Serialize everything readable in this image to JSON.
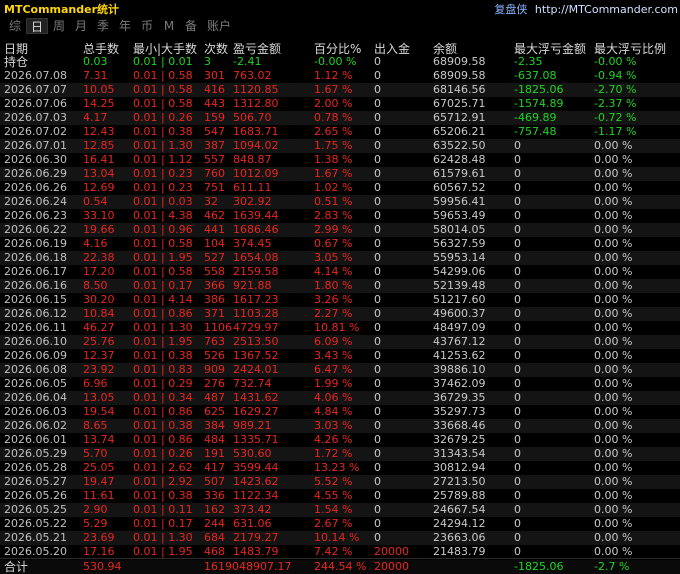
{
  "app_title": "MTCommander统计",
  "top_right": {
    "label": "复盘侠",
    "site": "http://MTCommander.com"
  },
  "tabs": [
    {
      "label": "综"
    },
    {
      "label": "日"
    },
    {
      "label": "周"
    },
    {
      "label": "月"
    },
    {
      "label": "季"
    },
    {
      "label": "年"
    },
    {
      "label": "币"
    },
    {
      "label": "M"
    },
    {
      "label": "备"
    },
    {
      "label": "账户"
    }
  ],
  "active_tab": "日",
  "headers": [
    "日期",
    "总手数",
    "最小|大手数",
    "次数",
    "盈亏金额",
    "百分比%",
    "出入金",
    "余额",
    "最大浮亏金额",
    "最大浮亏比例"
  ],
  "holding": {
    "label": "持仓",
    "lots": "0.03",
    "minmax": "0.01 | 0.01",
    "count": "3",
    "pnl": "-2.41",
    "pct": "-0.00 %",
    "flow": "0",
    "balance": "68909.58",
    "maxdd": "-2.35",
    "maxdd_pct": "-0.00 %"
  },
  "rows": [
    {
      "date": "2026.07.08",
      "lots": "7.31",
      "minmax": "0.01 | 0.58",
      "count": "301",
      "pnl": "763.02",
      "pct": "1.12 %",
      "flow": "0",
      "balance": "68909.58",
      "maxdd": "-637.08",
      "maxdd_pct": "-0.94 %"
    },
    {
      "date": "2026.07.07",
      "lots": "10.05",
      "minmax": "0.01 | 0.58",
      "count": "416",
      "pnl": "1120.85",
      "pct": "1.67 %",
      "flow": "0",
      "balance": "68146.56",
      "maxdd": "-1825.06",
      "maxdd_pct": "-2.70 %"
    },
    {
      "date": "2026.07.06",
      "lots": "14.25",
      "minmax": "0.01 | 0.58",
      "count": "443",
      "pnl": "1312.80",
      "pct": "2.00 %",
      "flow": "0",
      "balance": "67025.71",
      "maxdd": "-1574.89",
      "maxdd_pct": "-2.37 %"
    },
    {
      "date": "2026.07.03",
      "lots": "4.17",
      "minmax": "0.01 | 0.26",
      "count": "159",
      "pnl": "506.70",
      "pct": "0.78 %",
      "flow": "0",
      "balance": "65712.91",
      "maxdd": "-469.89",
      "maxdd_pct": "-0.72 %"
    },
    {
      "date": "2026.07.02",
      "lots": "12.43",
      "minmax": "0.01 | 0.38",
      "count": "547",
      "pnl": "1683.71",
      "pct": "2.65 %",
      "flow": "0",
      "balance": "65206.21",
      "maxdd": "-757.48",
      "maxdd_pct": "-1.17 %"
    },
    {
      "date": "2026.07.01",
      "lots": "12.85",
      "minmax": "0.01 | 1.30",
      "count": "387",
      "pnl": "1094.02",
      "pct": "1.75 %",
      "flow": "0",
      "balance": "63522.50",
      "maxdd": "0",
      "maxdd_pct": "0.00 %"
    },
    {
      "date": "2026.06.30",
      "lots": "16.41",
      "minmax": "0.01 | 1.12",
      "count": "557",
      "pnl": "848.87",
      "pct": "1.38 %",
      "flow": "0",
      "balance": "62428.48",
      "maxdd": "0",
      "maxdd_pct": "0.00 %"
    },
    {
      "date": "2026.06.29",
      "lots": "13.04",
      "minmax": "0.01 | 0.23",
      "count": "760",
      "pnl": "1012.09",
      "pct": "1.67 %",
      "flow": "0",
      "balance": "61579.61",
      "maxdd": "0",
      "maxdd_pct": "0.00 %"
    },
    {
      "date": "2026.06.26",
      "lots": "12.69",
      "minmax": "0.01 | 0.23",
      "count": "751",
      "pnl": "611.11",
      "pct": "1.02 %",
      "flow": "0",
      "balance": "60567.52",
      "maxdd": "0",
      "maxdd_pct": "0.00 %"
    },
    {
      "date": "2026.06.24",
      "lots": "0.54",
      "minmax": "0.01 | 0.03",
      "count": "32",
      "pnl": "302.92",
      "pct": "0.51 %",
      "flow": "0",
      "balance": "59956.41",
      "maxdd": "0",
      "maxdd_pct": "0.00 %"
    },
    {
      "date": "2026.06.23",
      "lots": "33.10",
      "minmax": "0.01 | 4.38",
      "count": "462",
      "pnl": "1639.44",
      "pct": "2.83 %",
      "flow": "0",
      "balance": "59653.49",
      "maxdd": "0",
      "maxdd_pct": "0.00 %"
    },
    {
      "date": "2026.06.22",
      "lots": "19.66",
      "minmax": "0.01 | 0.96",
      "count": "441",
      "pnl": "1686.46",
      "pct": "2.99 %",
      "flow": "0",
      "balance": "58014.05",
      "maxdd": "0",
      "maxdd_pct": "0.00 %"
    },
    {
      "date": "2026.06.19",
      "lots": "4.16",
      "minmax": "0.01 | 0.58",
      "count": "104",
      "pnl": "374.45",
      "pct": "0.67 %",
      "flow": "0",
      "balance": "56327.59",
      "maxdd": "0",
      "maxdd_pct": "0.00 %"
    },
    {
      "date": "2026.06.18",
      "lots": "22.38",
      "minmax": "0.01 | 1.95",
      "count": "527",
      "pnl": "1654.08",
      "pct": "3.05 %",
      "flow": "0",
      "balance": "55953.14",
      "maxdd": "0",
      "maxdd_pct": "0.00 %"
    },
    {
      "date": "2026.06.17",
      "lots": "17.20",
      "minmax": "0.01 | 0.58",
      "count": "558",
      "pnl": "2159.58",
      "pct": "4.14 %",
      "flow": "0",
      "balance": "54299.06",
      "maxdd": "0",
      "maxdd_pct": "0.00 %"
    },
    {
      "date": "2026.06.16",
      "lots": "8.50",
      "minmax": "0.01 | 0.17",
      "count": "366",
      "pnl": "921.88",
      "pct": "1.80 %",
      "flow": "0",
      "balance": "52139.48",
      "maxdd": "0",
      "maxdd_pct": "0.00 %"
    },
    {
      "date": "2026.06.15",
      "lots": "30.20",
      "minmax": "0.01 | 4.14",
      "count": "386",
      "pnl": "1617.23",
      "pct": "3.26 %",
      "flow": "0",
      "balance": "51217.60",
      "maxdd": "0",
      "maxdd_pct": "0.00 %"
    },
    {
      "date": "2026.06.12",
      "lots": "10.84",
      "minmax": "0.01 | 0.86",
      "count": "371",
      "pnl": "1103.28",
      "pct": "2.27 %",
      "flow": "0",
      "balance": "49600.37",
      "maxdd": "0",
      "maxdd_pct": "0.00 %"
    },
    {
      "date": "2026.06.11",
      "lots": "46.27",
      "minmax": "0.01 | 1.30",
      "count": "1106",
      "pnl": "4729.97",
      "pct": "10.81 %",
      "flow": "0",
      "balance": "48497.09",
      "maxdd": "0",
      "maxdd_pct": "0.00 %"
    },
    {
      "date": "2026.06.10",
      "lots": "25.76",
      "minmax": "0.01 | 1.95",
      "count": "763",
      "pnl": "2513.50",
      "pct": "6.09 %",
      "flow": "0",
      "balance": "43767.12",
      "maxdd": "0",
      "maxdd_pct": "0.00 %"
    },
    {
      "date": "2026.06.09",
      "lots": "12.37",
      "minmax": "0.01 | 0.38",
      "count": "526",
      "pnl": "1367.52",
      "pct": "3.43 %",
      "flow": "0",
      "balance": "41253.62",
      "maxdd": "0",
      "maxdd_pct": "0.00 %"
    },
    {
      "date": "2026.06.08",
      "lots": "23.92",
      "minmax": "0.01 | 0.83",
      "count": "909",
      "pnl": "2424.01",
      "pct": "6.47 %",
      "flow": "0",
      "balance": "39886.10",
      "maxdd": "0",
      "maxdd_pct": "0.00 %"
    },
    {
      "date": "2026.06.05",
      "lots": "6.96",
      "minmax": "0.01 | 0.29",
      "count": "276",
      "pnl": "732.74",
      "pct": "1.99 %",
      "flow": "0",
      "balance": "37462.09",
      "maxdd": "0",
      "maxdd_pct": "0.00 %"
    },
    {
      "date": "2026.06.04",
      "lots": "13.05",
      "minmax": "0.01 | 0.34",
      "count": "487",
      "pnl": "1431.62",
      "pct": "4.06 %",
      "flow": "0",
      "balance": "36729.35",
      "maxdd": "0",
      "maxdd_pct": "0.00 %"
    },
    {
      "date": "2026.06.03",
      "lots": "19.54",
      "minmax": "0.01 | 0.86",
      "count": "625",
      "pnl": "1629.27",
      "pct": "4.84 %",
      "flow": "0",
      "balance": "35297.73",
      "maxdd": "0",
      "maxdd_pct": "0.00 %"
    },
    {
      "date": "2026.06.02",
      "lots": "8.65",
      "minmax": "0.01 | 0.38",
      "count": "384",
      "pnl": "989.21",
      "pct": "3.03 %",
      "flow": "0",
      "balance": "33668.46",
      "maxdd": "0",
      "maxdd_pct": "0.00 %"
    },
    {
      "date": "2026.06.01",
      "lots": "13.74",
      "minmax": "0.01 | 0.86",
      "count": "484",
      "pnl": "1335.71",
      "pct": "4.26 %",
      "flow": "0",
      "balance": "32679.25",
      "maxdd": "0",
      "maxdd_pct": "0.00 %"
    },
    {
      "date": "2026.05.29",
      "lots": "5.70",
      "minmax": "0.01 | 0.26",
      "count": "191",
      "pnl": "530.60",
      "pct": "1.72 %",
      "flow": "0",
      "balance": "31343.54",
      "maxdd": "0",
      "maxdd_pct": "0.00 %"
    },
    {
      "date": "2026.05.28",
      "lots": "25.05",
      "minmax": "0.01 | 2.62",
      "count": "417",
      "pnl": "3599.44",
      "pct": "13.23 %",
      "flow": "0",
      "balance": "30812.94",
      "maxdd": "0",
      "maxdd_pct": "0.00 %"
    },
    {
      "date": "2026.05.27",
      "lots": "19.47",
      "minmax": "0.01 | 2.92",
      "count": "507",
      "pnl": "1423.62",
      "pct": "5.52 %",
      "flow": "0",
      "balance": "27213.50",
      "maxdd": "0",
      "maxdd_pct": "0.00 %"
    },
    {
      "date": "2026.05.26",
      "lots": "11.61",
      "minmax": "0.01 | 0.38",
      "count": "336",
      "pnl": "1122.34",
      "pct": "4.55 %",
      "flow": "0",
      "balance": "25789.88",
      "maxdd": "0",
      "maxdd_pct": "0.00 %"
    },
    {
      "date": "2026.05.25",
      "lots": "2.90",
      "minmax": "0.01 | 0.11",
      "count": "162",
      "pnl": "373.42",
      "pct": "1.54 %",
      "flow": "0",
      "balance": "24667.54",
      "maxdd": "0",
      "maxdd_pct": "0.00 %"
    },
    {
      "date": "2026.05.22",
      "lots": "5.29",
      "minmax": "0.01 | 0.17",
      "count": "244",
      "pnl": "631.06",
      "pct": "2.67 %",
      "flow": "0",
      "balance": "24294.12",
      "maxdd": "0",
      "maxdd_pct": "0.00 %"
    },
    {
      "date": "2026.05.21",
      "lots": "23.69",
      "minmax": "0.01 | 1.30",
      "count": "684",
      "pnl": "2179.27",
      "pct": "10.14 %",
      "flow": "0",
      "balance": "23663.06",
      "maxdd": "0",
      "maxdd_pct": "0.00 %"
    },
    {
      "date": "2026.05.20",
      "lots": "17.16",
      "minmax": "0.01 | 1.95",
      "count": "468",
      "pnl": "1483.79",
      "pct": "7.42 %",
      "flow": "20000",
      "balance": "21483.79",
      "maxdd": "0",
      "maxdd_pct": "0.00 %"
    }
  ],
  "total": {
    "label": "合计",
    "lots": "530.94",
    "count_pnl": "1619048907.17",
    "pct": "244.54 %",
    "flow": "20000",
    "maxdd": "-1825.06",
    "maxdd_pct": "-2.7 %"
  },
  "colors": {
    "profit": "#e8261f",
    "loss": "#1fd61f",
    "title": "#ffd700",
    "link": "#8ab4ff"
  }
}
